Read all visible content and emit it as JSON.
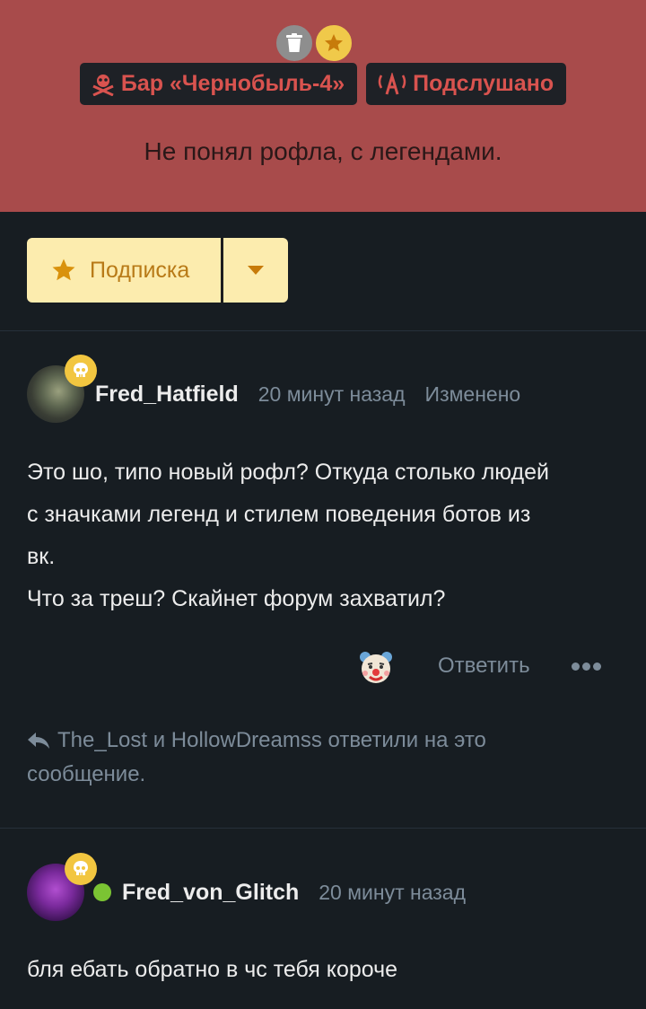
{
  "header": {
    "tags": [
      {
        "icon": "skull-crossbones-icon",
        "label": "Бар «Чернобыль-4»"
      },
      {
        "icon": "radio-broadcast-icon",
        "label": "Подслушано"
      }
    ],
    "text": "Не понял рофла, с легендами.",
    "background": "#a84b4b"
  },
  "subscribe": {
    "label": "Подписка"
  },
  "posts": [
    {
      "username": "Fred_Hatfield",
      "time": "20 минут назад",
      "edited": "Изменено",
      "lines": [
        "Это шо, типо новый рофл? Откуда столько людей",
        "с значками легенд и стилем поведения ботов из",
        "вк.",
        "Что за треш? Скайнет форум захватил?"
      ],
      "reaction_icon": "clown-face-icon",
      "reply_label": "Ответить",
      "replied_text": "The_Lost и HollowDreamss ответили на это сообщение."
    },
    {
      "username": "Fred_von_Glitch",
      "time": "20 минут назад",
      "lines": [
        "бля ебать обратно в чс тебя короче"
      ]
    }
  ]
}
